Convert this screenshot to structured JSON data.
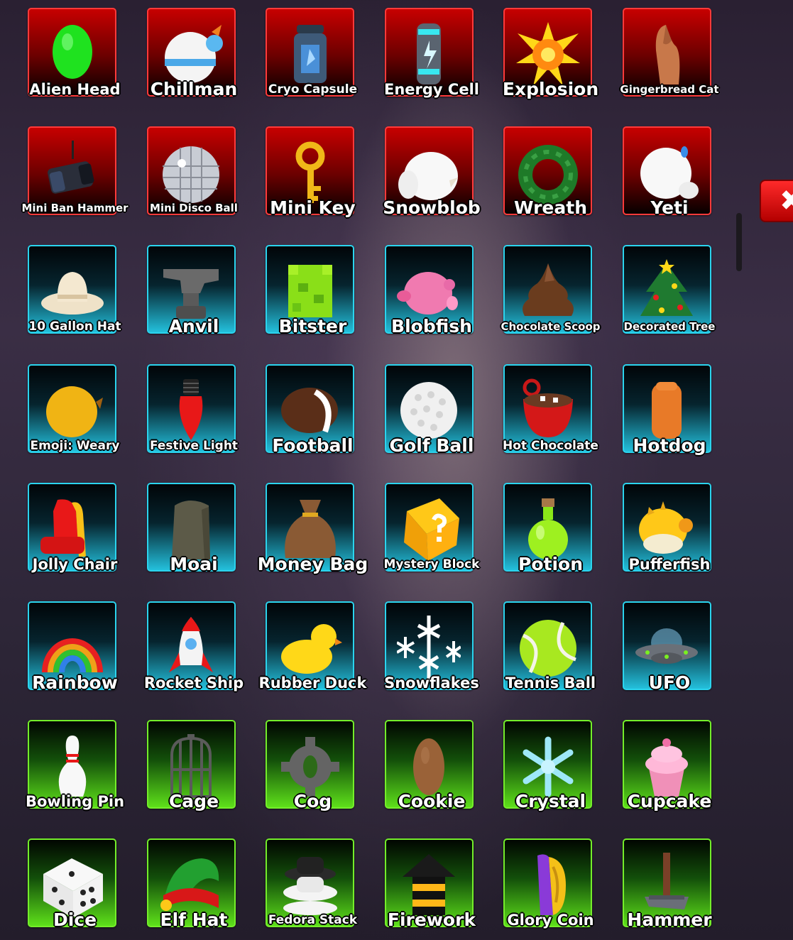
{
  "close_button": {
    "glyph": "✖"
  },
  "items": [
    {
      "name": "Alien Head",
      "rarity": "legendary",
      "icon": "alien-head-icon"
    },
    {
      "name": "Chillman",
      "rarity": "legendary",
      "icon": "chillman-icon"
    },
    {
      "name": "Cryo Capsule",
      "rarity": "legendary",
      "icon": "cryo-capsule-icon"
    },
    {
      "name": "Energy Cell",
      "rarity": "legendary",
      "icon": "energy-cell-icon"
    },
    {
      "name": "Explosion",
      "rarity": "legendary",
      "icon": "explosion-icon"
    },
    {
      "name": "Gingerbread Cat",
      "rarity": "legendary",
      "icon": "gingerbread-cat-icon"
    },
    {
      "name": "Mini Ban Hammer",
      "rarity": "legendary",
      "icon": "mini-ban-hammer-icon"
    },
    {
      "name": "Mini Disco Ball",
      "rarity": "legendary",
      "icon": "mini-disco-ball-icon"
    },
    {
      "name": "Mini Key",
      "rarity": "legendary",
      "icon": "mini-key-icon"
    },
    {
      "name": "Snowblob",
      "rarity": "legendary",
      "icon": "snowblob-icon"
    },
    {
      "name": "Wreath",
      "rarity": "legendary",
      "icon": "wreath-icon"
    },
    {
      "name": "Yeti",
      "rarity": "legendary",
      "icon": "yeti-icon"
    },
    {
      "name": "10 Gallon Hat",
      "rarity": "epic",
      "icon": "cowboy-hat-icon"
    },
    {
      "name": "Anvil",
      "rarity": "epic",
      "icon": "anvil-icon"
    },
    {
      "name": "Bitster",
      "rarity": "epic",
      "icon": "bitster-icon"
    },
    {
      "name": "Blobfish",
      "rarity": "epic",
      "icon": "blobfish-icon"
    },
    {
      "name": "Chocolate Scoop",
      "rarity": "epic",
      "icon": "chocolate-scoop-icon"
    },
    {
      "name": "Decorated Tree",
      "rarity": "epic",
      "icon": "decorated-tree-icon"
    },
    {
      "name": "Emoji: Weary",
      "rarity": "epic",
      "icon": "emoji-weary-icon"
    },
    {
      "name": "Festive Light",
      "rarity": "epic",
      "icon": "festive-light-icon"
    },
    {
      "name": "Football",
      "rarity": "epic",
      "icon": "football-icon"
    },
    {
      "name": "Golf Ball",
      "rarity": "epic",
      "icon": "golf-ball-icon"
    },
    {
      "name": "Hot Chocolate",
      "rarity": "epic",
      "icon": "hot-chocolate-icon"
    },
    {
      "name": "Hotdog",
      "rarity": "epic",
      "icon": "hotdog-icon"
    },
    {
      "name": "Jolly Chair",
      "rarity": "epic",
      "icon": "jolly-chair-icon"
    },
    {
      "name": "Moai",
      "rarity": "epic",
      "icon": "moai-icon"
    },
    {
      "name": "Money Bag",
      "rarity": "epic",
      "icon": "money-bag-icon"
    },
    {
      "name": "Mystery Block",
      "rarity": "epic",
      "icon": "mystery-block-icon"
    },
    {
      "name": "Potion",
      "rarity": "epic",
      "icon": "potion-icon"
    },
    {
      "name": "Pufferfish",
      "rarity": "epic",
      "icon": "pufferfish-icon"
    },
    {
      "name": "Rainbow",
      "rarity": "epic",
      "icon": "rainbow-icon"
    },
    {
      "name": "Rocket Ship",
      "rarity": "epic",
      "icon": "rocket-ship-icon"
    },
    {
      "name": "Rubber Duck",
      "rarity": "epic",
      "icon": "rubber-duck-icon"
    },
    {
      "name": "Snowflakes",
      "rarity": "epic",
      "icon": "snowflakes-icon"
    },
    {
      "name": "Tennis Ball",
      "rarity": "epic",
      "icon": "tennis-ball-icon"
    },
    {
      "name": "UFO",
      "rarity": "epic",
      "icon": "ufo-icon"
    },
    {
      "name": "Bowling Pin",
      "rarity": "rare",
      "icon": "bowling-pin-icon"
    },
    {
      "name": "Cage",
      "rarity": "rare",
      "icon": "cage-icon"
    },
    {
      "name": "Cog",
      "rarity": "rare",
      "icon": "cog-icon"
    },
    {
      "name": "Cookie",
      "rarity": "rare",
      "icon": "cookie-icon"
    },
    {
      "name": "Crystal",
      "rarity": "rare",
      "icon": "crystal-icon"
    },
    {
      "name": "Cupcake",
      "rarity": "rare",
      "icon": "cupcake-icon"
    },
    {
      "name": "Dice",
      "rarity": "rare",
      "icon": "dice-icon"
    },
    {
      "name": "Elf Hat",
      "rarity": "rare",
      "icon": "elf-hat-icon"
    },
    {
      "name": "Fedora Stack",
      "rarity": "rare",
      "icon": "fedora-stack-icon"
    },
    {
      "name": "Firework",
      "rarity": "rare",
      "icon": "firework-icon"
    },
    {
      "name": "Glory Coin",
      "rarity": "rare",
      "icon": "glory-coin-icon"
    },
    {
      "name": "Hammer",
      "rarity": "rare",
      "icon": "hammer-icon"
    }
  ]
}
